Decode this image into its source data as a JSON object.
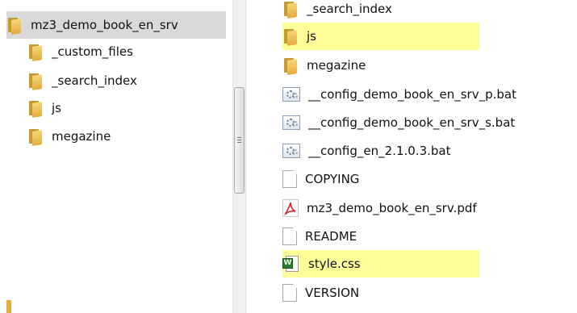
{
  "tree": {
    "items": [
      {
        "label": "mz3_demo_book_en_srv",
        "icon": "folder-icon",
        "selected": true
      },
      {
        "label": "_custom_files",
        "icon": "folder-icon"
      },
      {
        "label": "_search_index",
        "icon": "folder-icon"
      },
      {
        "label": "js",
        "icon": "folder-icon"
      },
      {
        "label": "megazine",
        "icon": "folder-icon"
      }
    ]
  },
  "files": {
    "items": [
      {
        "label": "_search_index",
        "icon": "folder-icon"
      },
      {
        "label": "js",
        "icon": "folder-icon",
        "highlighted": true
      },
      {
        "label": "megazine",
        "icon": "folder-icon"
      },
      {
        "label": "__config_demo_book_en_srv_p.bat",
        "icon": "batch-file-icon"
      },
      {
        "label": "__config_demo_book_en_srv_s.bat",
        "icon": "batch-file-icon"
      },
      {
        "label": "__config_en_2.1.0.3.bat",
        "icon": "batch-file-icon"
      },
      {
        "label": "COPYING",
        "icon": "document-icon"
      },
      {
        "label": "mz3_demo_book_en_srv.pdf",
        "icon": "pdf-icon"
      },
      {
        "label": "README",
        "icon": "document-icon"
      },
      {
        "label": "style.css",
        "icon": "word-document-icon",
        "highlighted": true
      },
      {
        "label": "VERSION",
        "icon": "document-icon"
      }
    ]
  },
  "colors": {
    "highlight": "#ffff9a",
    "selection": "#d9d9d9",
    "folder": "#e9b84f"
  }
}
